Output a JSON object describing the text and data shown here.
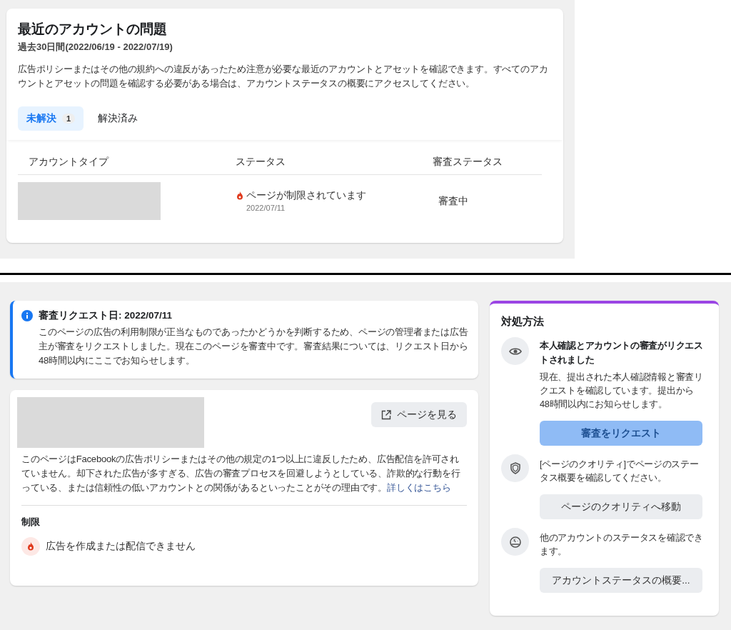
{
  "recent_issues": {
    "title": "最近のアカウントの問題",
    "period": "過去30日間(2022/06/19 - 2022/07/19)",
    "description": "広告ポリシーまたはその他の規約への違反があったため注意が必要な最近のアカウントとアセットを確認できます。すべてのアカウントとアセットの問題を確認する必要がある場合は、アカウントステータスの概要にアクセスしてください。",
    "tabs": [
      {
        "label": "未解決",
        "count": "1",
        "selected": true
      },
      {
        "label": "解決済み",
        "selected": false
      }
    ],
    "columns": [
      "アカウントタイプ",
      "ステータス",
      "審査ステータス"
    ],
    "rows": [
      {
        "status": "ページが制限されています",
        "date": "2022/07/11",
        "review_status": "審査中"
      }
    ]
  },
  "review_notice": {
    "title": "審査リクエスト日: 2022/07/11",
    "body": "このページの広告の利用制限が正当なものであったかどうかを判断するため、ページの管理者または広告主が審査をリクエストしました。現在このページを審査中です。審査結果については、リクエスト日から48時間以内にここでお知らせします。"
  },
  "page_card": {
    "view_page_button": "ページを見る",
    "description": "このページはFacebookの広告ポリシーまたはその他の規定の1つ以上に違反したため、広告配信を許可されていません。却下された広告が多すぎる、広告の審査プロセスを回避しようとしている、詐欺的な行動を行っている、または信頼性の低いアカウントとの関係があるといったことがその理由です。",
    "link": "詳しくはこちら",
    "restrictions_heading": "制限",
    "restrictions": [
      "広告を作成または配信できません"
    ]
  },
  "actions_panel": {
    "title": "対処方法",
    "items": [
      {
        "heading": "本人確認とアカウントの審査がリクエストされました",
        "text": "現在、提出された本人確認情報と審査リクエストを確認しています。提出から48時間以内にお知らせします。",
        "button": {
          "label": "審査をリクエスト",
          "disabled": true
        }
      },
      {
        "text": "[ページのクオリティ]でページのステータス概要を確認してください。",
        "button": {
          "label": "ページのクオリティへ移動",
          "disabled": false
        }
      },
      {
        "text": "他のアカウントのステータスを確認できます。",
        "button": {
          "label": "アカウントステータスの概要...",
          "disabled": false
        }
      }
    ]
  }
}
